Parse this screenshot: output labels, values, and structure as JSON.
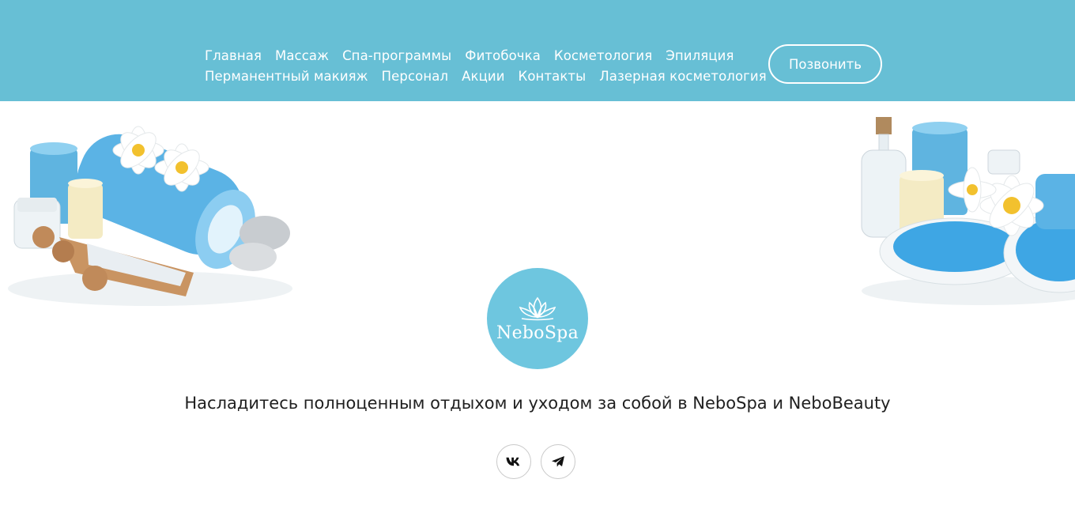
{
  "nav": {
    "row1": [
      "Главная",
      "Массаж",
      "Спа-программы",
      "Фитобочка",
      "Косметология",
      "Эпиляция"
    ],
    "row2": [
      "Перманентный макияж",
      "Персонал",
      "Акции",
      "Контакты",
      "Лазерная косметология"
    ]
  },
  "header": {
    "call_label": "Позвонить",
    "bg_color": "#67bfd5"
  },
  "logo": {
    "text": "NeboSpa",
    "color": "#6ec6df"
  },
  "tagline": "Насладитесь полноценным отдыхом и уходом за собой в NeboSpa и NeboBeauty",
  "socials": [
    {
      "icon": "vk-icon"
    },
    {
      "icon": "telegram-icon"
    }
  ]
}
